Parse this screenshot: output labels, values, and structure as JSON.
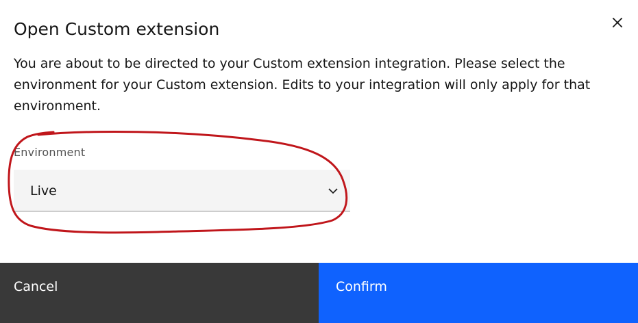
{
  "dialog": {
    "title": "Open Custom extension",
    "description": "You are about to be directed to your Custom extension integration. Please select the environment for your Custom extension. Edits to your integration will only apply for that environment.",
    "close_icon": "close-icon"
  },
  "environment_field": {
    "label": "Environment",
    "selected_value": "Live",
    "dropdown_icon": "chevron-down-icon"
  },
  "footer": {
    "cancel_label": "Cancel",
    "confirm_label": "Confirm"
  },
  "colors": {
    "cancel_bg": "#393939",
    "confirm_bg": "#0f62fe",
    "select_bg": "#f4f4f4",
    "annotation_stroke": "#c0161b"
  }
}
